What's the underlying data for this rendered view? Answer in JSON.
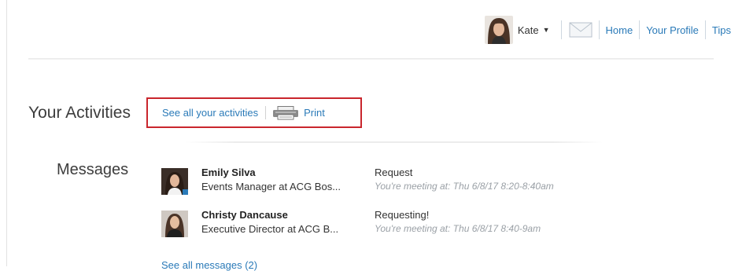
{
  "topnav": {
    "user_name": "Kate",
    "links": [
      "Home",
      "Your Profile",
      "Tips"
    ]
  },
  "activities": {
    "title": "Your Activities",
    "see_all_label": "See all your activities",
    "print_label": "Print"
  },
  "messages": {
    "title": "Messages",
    "items": [
      {
        "name": "Emily Silva",
        "title": "Events Manager at ACG Bos...",
        "subject": "Request",
        "meeting": "You're meeting at: Thu 6/8/17 8:20-8:40am"
      },
      {
        "name": "Christy Dancause",
        "title": "Executive Director at ACG B...",
        "subject": "Requesting!",
        "meeting": "You're meeting at: Thu 6/8/17 8:40-9am"
      }
    ],
    "see_all_label": "See all messages (2)"
  },
  "colors": {
    "link": "#2a7ab8",
    "highlight_border": "#c9262d"
  }
}
